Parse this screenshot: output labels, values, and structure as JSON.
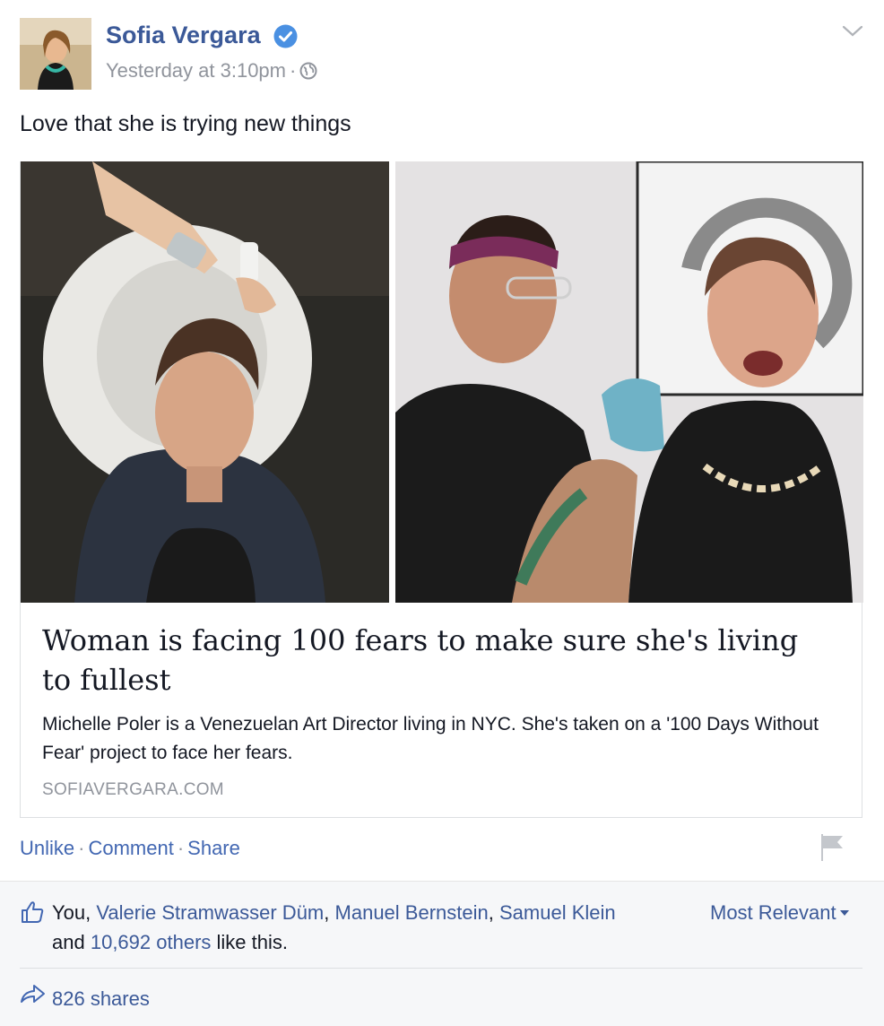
{
  "post": {
    "author": "Sofia Vergara",
    "timestamp": "Yesterday at 3:10pm",
    "meta_separator": "·",
    "text": "Love that she is trying new things",
    "icons": {
      "verified": "verified-badge-icon",
      "audience": "globe-icon",
      "options": "chevron-down-icon"
    }
  },
  "link": {
    "title": "Woman is facing 100 fears to make sure she's living to fullest",
    "description": "Michelle Poler is a Venezuelan Art Director living in NYC. She's taken on a '100 Days Without Fear' project to face her fears.",
    "domain": "SOFIAVERGARA.COM"
  },
  "actions": {
    "unlike": "Unlike",
    "comment": "Comment",
    "share": "Share",
    "separator": "·"
  },
  "reactions": {
    "prefix": "You,",
    "names": [
      "Valerie Stramwasser Düm",
      "Manuel Bernstein",
      "Samuel Klein"
    ],
    "comma": ",",
    "and": "and",
    "others": "10,692 others",
    "suffix": "like this.",
    "sort_label": "Most Relevant"
  },
  "shares": {
    "label": "826 shares"
  },
  "colors": {
    "link_blue": "#3b5998",
    "action_blue": "#4267b2",
    "meta_gray": "#90949c",
    "footer_bg": "#f6f7f9"
  }
}
